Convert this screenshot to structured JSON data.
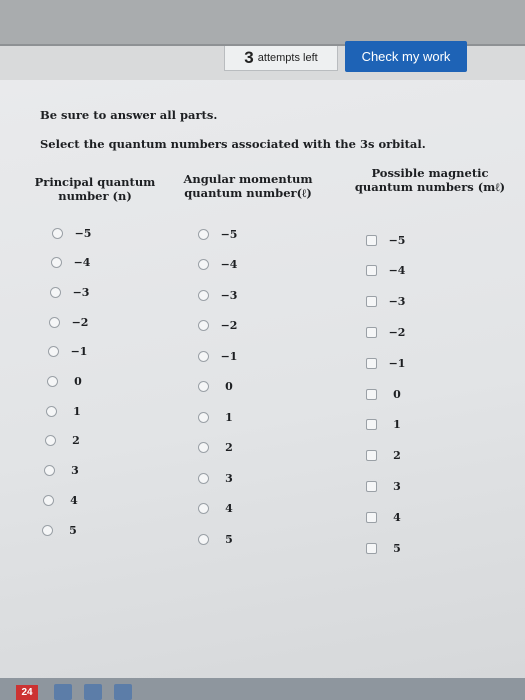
{
  "header": {
    "attempts_count": "3",
    "attempts_label": "attempts left",
    "check_button_label": "Check my work"
  },
  "instructions": {
    "line1": "Be sure to answer all parts.",
    "line2": "Select the quantum numbers associated with the 3s orbital."
  },
  "columns": {
    "n": {
      "title_line1": "Principal quantum",
      "title_line2": "number (n)"
    },
    "l": {
      "title_line1": "Angular momentum",
      "title_line2": "quantum number(ℓ)"
    },
    "ml": {
      "title_line1": "Possible magnetic",
      "title_line2": "quantum numbers (mℓ)"
    }
  },
  "values": [
    "−5",
    "−4",
    "−3",
    "−2",
    "−1",
    "0",
    "1",
    "2",
    "3",
    "4",
    "5"
  ],
  "taskbar": {
    "date_badge": "24"
  }
}
